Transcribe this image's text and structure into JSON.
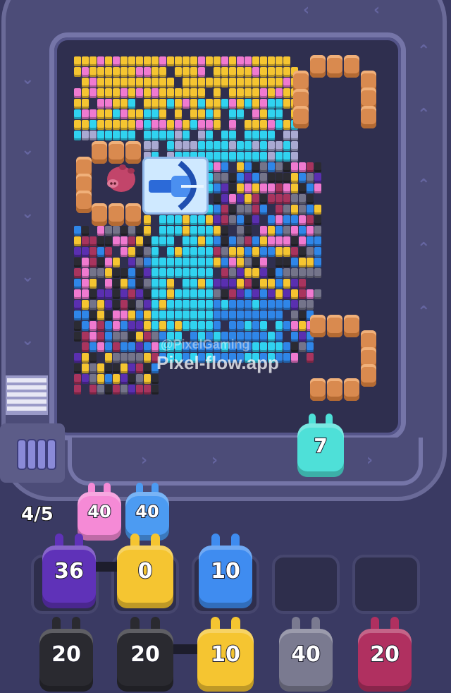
{
  "colors": {
    "yellow": "#f5c531",
    "pink": "#f07ad0",
    "cyan": "#30d3f0",
    "blue": "#2f86e8",
    "dark": "#2b2b33",
    "gray": "#74748a",
    "purple": "#5a2fb0",
    "magenta": "#a8345e",
    "black": "#1c1c22",
    "lavender": "#a9a9d2"
  },
  "watermark": {
    "line1": "@PixelGaming",
    "line2": "Pixel-flow.app"
  },
  "capacity_counter": "4/5",
  "active_bunny": {
    "value": "7",
    "color": "#4ee0d8"
  },
  "queue_top": [
    {
      "value": "40",
      "color": "#f58ad6"
    },
    {
      "value": "40",
      "color": "#4c9bf2"
    }
  ],
  "row_middle": [
    {
      "value": "36",
      "color": "#5f32b8"
    },
    {
      "value": "0",
      "color": "#f5c531"
    },
    {
      "value": "10",
      "color": "#3f8cf0"
    }
  ],
  "row_bottom": [
    {
      "value": "20",
      "color": "#2a2a30"
    },
    {
      "value": "20",
      "color": "#2a2a30"
    },
    {
      "value": "10",
      "color": "#f5c531"
    },
    {
      "value": "40",
      "color": "#7a7a90"
    },
    {
      "value": "20",
      "color": "#b03060"
    }
  ],
  "icons": [
    "crossbow-icon",
    "pig-icon",
    "chevron-icon"
  ]
}
